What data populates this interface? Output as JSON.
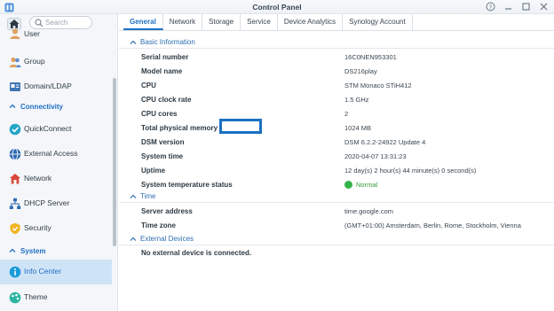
{
  "window": {
    "title": "Control Panel"
  },
  "sidebar": {
    "search_placeholder": "Search",
    "items_top": [
      {
        "label": "User",
        "icon": "user-icon"
      },
      {
        "label": "Group",
        "icon": "group-icon"
      },
      {
        "label": "Domain/LDAP",
        "icon": "domain-ldap-icon"
      }
    ],
    "section_connectivity": "Connectivity",
    "items_connectivity": [
      {
        "label": "QuickConnect",
        "icon": "quickconnect-icon"
      },
      {
        "label": "External Access",
        "icon": "external-access-icon"
      },
      {
        "label": "Network",
        "icon": "network-icon"
      },
      {
        "label": "DHCP Server",
        "icon": "dhcp-server-icon"
      },
      {
        "label": "Security",
        "icon": "security-shield-icon"
      }
    ],
    "section_system": "System",
    "items_system": [
      {
        "label": "Info Center",
        "icon": "info-center-icon",
        "active": true
      },
      {
        "label": "Theme",
        "icon": "theme-icon"
      }
    ]
  },
  "tabs": [
    "General",
    "Network",
    "Storage",
    "Service",
    "Device Analytics",
    "Synology Account"
  ],
  "active_tab": "General",
  "basic_info": {
    "title": "Basic Information",
    "rows": [
      {
        "key": "Serial number",
        "value": "16C0NEN953301"
      },
      {
        "key": "Model name",
        "value": "DS216play"
      },
      {
        "key": "CPU",
        "value": "STM Monaco STiH412"
      },
      {
        "key": "CPU clock rate",
        "value": "1.5 GHz"
      },
      {
        "key": "CPU cores",
        "value": "2"
      },
      {
        "key": "Total physical memory",
        "value": "1024 MB"
      },
      {
        "key": "DSM version",
        "value": "DSM 6.2.2-24922 Update 4"
      },
      {
        "key": "System time",
        "value": "2020-04-07 13:31:23"
      },
      {
        "key": "Uptime",
        "value": "12 day(s) 2 hour(s) 44 minute(s) 0 second(s)"
      },
      {
        "key": "System temperature status",
        "value": "Normal"
      }
    ]
  },
  "time_section": {
    "title": "Time",
    "rows": [
      {
        "key": "Server address",
        "value": "time.google.com"
      },
      {
        "key": "Time zone",
        "value": "(GMT+01:00) Amsterdam, Berlin, Rome, Stockholm, Vienna"
      }
    ]
  },
  "external_devices": {
    "title": "External Devices",
    "message": "No external device is connected."
  },
  "colors": {
    "accent": "#1f6fc5",
    "active_bg": "#cfe3f7",
    "status_ok": "#33b34a",
    "highlight_border": "#1b6fc2"
  }
}
